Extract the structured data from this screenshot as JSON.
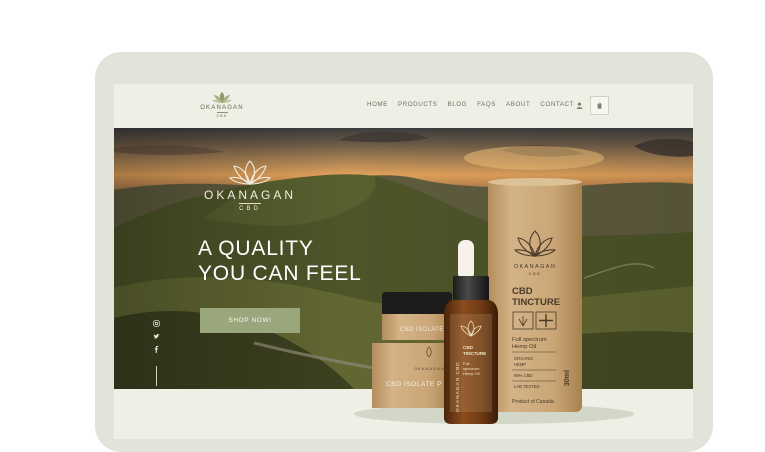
{
  "header": {
    "logo": {
      "brand": "OKANAGAN",
      "sub": "CBD"
    },
    "nav": [
      "HOME",
      "PRODUCTS",
      "BLOG",
      "FAQS",
      "ABOUT",
      "CONTACT"
    ],
    "icons": {
      "account": "user-icon",
      "cart": "bag-icon"
    }
  },
  "hero": {
    "logo": {
      "brand": "OKANAGAN",
      "sub": "CBD"
    },
    "tagline_line1": "A QUALITY",
    "tagline_line2": "YOU CAN FEEL",
    "cta": "SHOP NOW!",
    "social": [
      "instagram-icon",
      "twitter-icon",
      "facebook-icon"
    ]
  },
  "products": {
    "tube": {
      "brand": "OKANAGAN",
      "sub": "CBD",
      "title1": "CBD",
      "title2": "TINCTURE",
      "desc1": "Full spectrum",
      "desc2": "Hemp Oil",
      "badge1a": "ORGANIC",
      "badge1b": "HEMP",
      "badge2": "99% CBD",
      "badge3": "LAB TESTED",
      "volume": "30ml",
      "origin": "Product of Canada"
    },
    "bottle": {
      "title1": "CBD",
      "title2": "TINCTURE",
      "desc1": "Full",
      "desc2": "spectrum",
      "desc3": "Hemp Oil",
      "side": "OKANAGAN CBD"
    },
    "jar": {
      "label": "CBD ISOLATE P"
    },
    "box": {
      "brand": "OKANAGAN",
      "label": "CBD ISOLATE P"
    }
  },
  "colors": {
    "frame": "#e1e4d8",
    "background": "#eef0e6",
    "cta": "#9aa77c",
    "kraft": "#c9a779",
    "amber": "#6a3a16"
  }
}
